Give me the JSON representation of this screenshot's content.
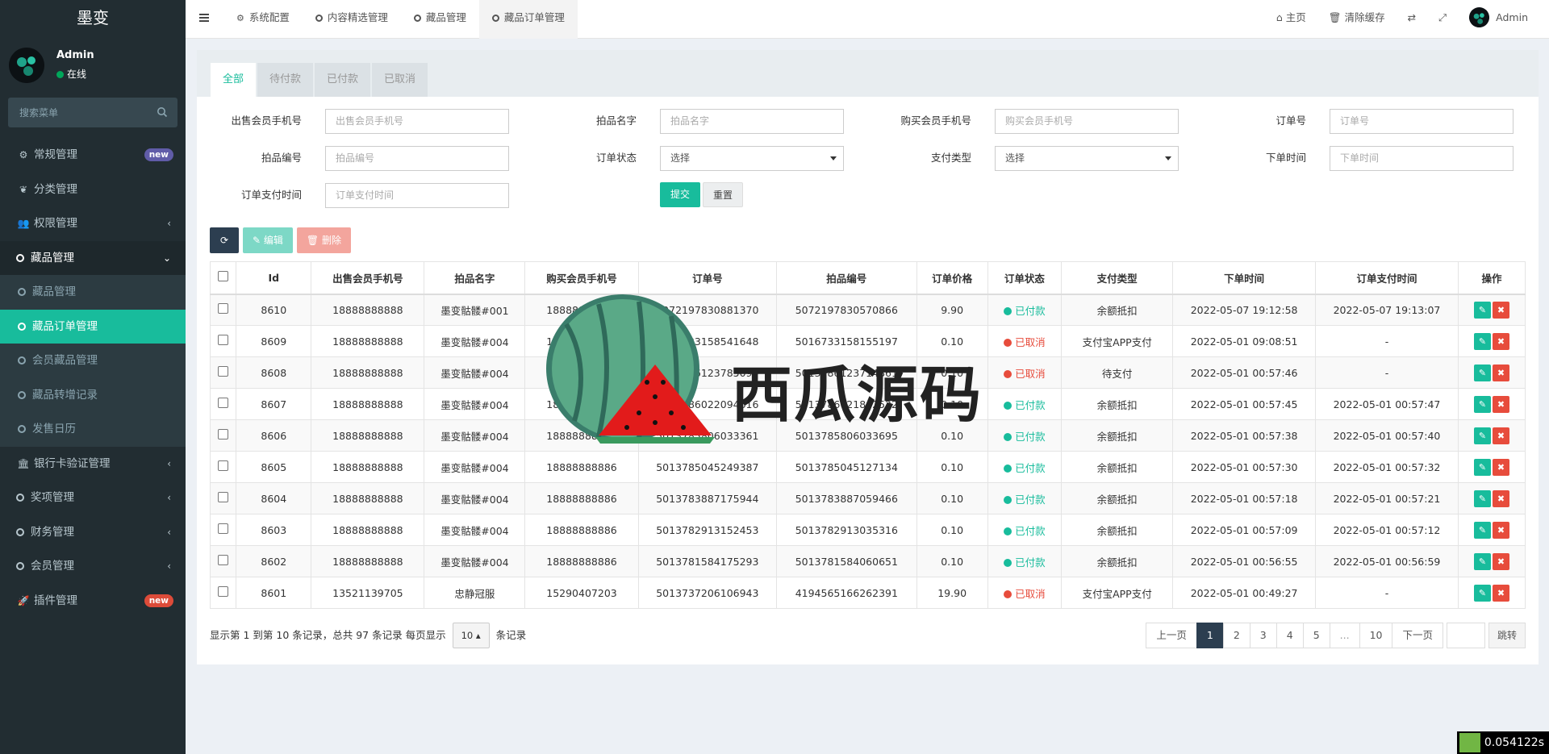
{
  "app": {
    "logo_text": "墨变",
    "user": {
      "name": "Admin",
      "status": "在线"
    },
    "search_placeholder": "搜索菜单"
  },
  "sidebar": {
    "items": [
      {
        "label": "常规管理",
        "icon": "gears-icon",
        "badge": "new",
        "badge_color": "#605ca8"
      },
      {
        "label": "分类管理",
        "icon": "leaf-icon"
      },
      {
        "label": "权限管理",
        "icon": "users-icon",
        "chevron": "left"
      },
      {
        "label": "藏品管理",
        "icon": "circle-icon",
        "chevron": "down",
        "expanded": true
      },
      {
        "label": "藏品管理",
        "icon": "circle-icon",
        "sub": true
      },
      {
        "label": "藏品订单管理",
        "icon": "circle-icon",
        "sub": true,
        "active": true
      },
      {
        "label": "会员藏品管理",
        "icon": "circle-icon",
        "sub": true
      },
      {
        "label": "藏品转增记录",
        "icon": "circle-icon",
        "sub": true
      },
      {
        "label": "发售日历",
        "icon": "circle-icon",
        "sub": true
      },
      {
        "label": "银行卡验证管理",
        "icon": "bank-icon",
        "chevron": "left"
      },
      {
        "label": "奖项管理",
        "icon": "circle-icon",
        "chevron": "left"
      },
      {
        "label": "财务管理",
        "icon": "circle-icon",
        "chevron": "left"
      },
      {
        "label": "会员管理",
        "icon": "circle-icon",
        "chevron": "left"
      },
      {
        "label": "插件管理",
        "icon": "rocket-icon",
        "badge": "new",
        "badge_color": "#dd4b39"
      }
    ]
  },
  "topbar": {
    "tabs": [
      {
        "label": "系统配置",
        "icon": "gear-icon"
      },
      {
        "label": "内容精选管理",
        "icon": "circle-icon"
      },
      {
        "label": "藏品管理",
        "icon": "circle-icon"
      },
      {
        "label": "藏品订单管理",
        "icon": "circle-icon",
        "active": true
      }
    ],
    "home_label": "主页",
    "clear_cache_label": "清除缓存",
    "user_name": "Admin"
  },
  "panel": {
    "tabs": [
      "全部",
      "待付款",
      "已付款",
      "已取消"
    ],
    "active_tab": 0
  },
  "filters": {
    "seller_phone": {
      "label": "出售会员手机号",
      "placeholder": "出售会员手机号"
    },
    "item_name": {
      "label": "拍品名字",
      "placeholder": "拍品名字"
    },
    "buyer_phone": {
      "label": "购买会员手机号",
      "placeholder": "购买会员手机号"
    },
    "order_no": {
      "label": "订单号",
      "placeholder": "订单号"
    },
    "item_no": {
      "label": "拍品编号",
      "placeholder": "拍品编号"
    },
    "order_status": {
      "label": "订单状态",
      "value": "选择"
    },
    "pay_type": {
      "label": "支付类型",
      "value": "选择"
    },
    "order_time": {
      "label": "下单时间",
      "placeholder": "下单时间"
    },
    "pay_time": {
      "label": "订单支付时间",
      "placeholder": "订单支付时间"
    },
    "submit_label": "提交",
    "reset_label": "重置"
  },
  "toolbar": {
    "edit_label": "编辑",
    "delete_label": "删除"
  },
  "table": {
    "columns": [
      "Id",
      "出售会员手机号",
      "拍品名字",
      "购买会员手机号",
      "订单号",
      "拍品编号",
      "订单价格",
      "订单状态",
      "支付类型",
      "下单时间",
      "订单支付时间",
      "操作"
    ],
    "rows": [
      {
        "id": "8610",
        "seller": "18888888888",
        "name": "墨变骷髅#001",
        "buyer": "18888888888",
        "order": "5072197830881370",
        "item": "5072197830570866",
        "price": "9.90",
        "status": "已付款",
        "status_type": "paid",
        "pay": "余额抵扣",
        "pay_type": "green",
        "created": "2022-05-07 19:12:58",
        "paid": "2022-05-07 19:13:07"
      },
      {
        "id": "8609",
        "seller": "18888888888",
        "name": "墨变骷髅#004",
        "buyer": "18950590989",
        "order": "5016733158541648",
        "item": "5016733158155197",
        "price": "0.10",
        "status": "已取消",
        "status_type": "cancel",
        "pay": "支付宝APP支付",
        "pay_type": "red",
        "created": "2022-05-01 09:08:51",
        "paid": "-"
      },
      {
        "id": "8608",
        "seller": "18888888888",
        "name": "墨变骷髅#004",
        "buyer": "18888888886",
        "order": "5013786123785099",
        "item": "5013786123714861",
        "price": "0.10",
        "status": "已取消",
        "status_type": "cancel",
        "pay": "待支付",
        "pay_type": "plain",
        "created": "2022-05-01 00:57:46",
        "paid": "-"
      },
      {
        "id": "8607",
        "seller": "18888888888",
        "name": "墨变骷髅#004",
        "buyer": "18888888886",
        "order": "5013786022094616",
        "item": "5013786021862522",
        "price": "0.10",
        "status": "已付款",
        "status_type": "paid",
        "pay": "余额抵扣",
        "pay_type": "green",
        "created": "2022-05-01 00:57:45",
        "paid": "2022-05-01 00:57:47"
      },
      {
        "id": "8606",
        "seller": "18888888888",
        "name": "墨变骷髅#004",
        "buyer": "18888888886",
        "order": "5013785806033361",
        "item": "5013785806033695",
        "price": "0.10",
        "status": "已付款",
        "status_type": "paid",
        "pay": "余额抵扣",
        "pay_type": "green",
        "created": "2022-05-01 00:57:38",
        "paid": "2022-05-01 00:57:40"
      },
      {
        "id": "8605",
        "seller": "18888888888",
        "name": "墨变骷髅#004",
        "buyer": "18888888886",
        "order": "5013785045249387",
        "item": "5013785045127134",
        "price": "0.10",
        "status": "已付款",
        "status_type": "paid",
        "pay": "余额抵扣",
        "pay_type": "green",
        "created": "2022-05-01 00:57:30",
        "paid": "2022-05-01 00:57:32"
      },
      {
        "id": "8604",
        "seller": "18888888888",
        "name": "墨变骷髅#004",
        "buyer": "18888888886",
        "order": "5013783887175944",
        "item": "5013783887059466",
        "price": "0.10",
        "status": "已付款",
        "status_type": "paid",
        "pay": "余额抵扣",
        "pay_type": "green",
        "created": "2022-05-01 00:57:18",
        "paid": "2022-05-01 00:57:21"
      },
      {
        "id": "8603",
        "seller": "18888888888",
        "name": "墨变骷髅#004",
        "buyer": "18888888886",
        "order": "5013782913152453",
        "item": "5013782913035316",
        "price": "0.10",
        "status": "已付款",
        "status_type": "paid",
        "pay": "余额抵扣",
        "pay_type": "green",
        "created": "2022-05-01 00:57:09",
        "paid": "2022-05-01 00:57:12"
      },
      {
        "id": "8602",
        "seller": "18888888888",
        "name": "墨变骷髅#004",
        "buyer": "18888888886",
        "order": "5013781584175293",
        "item": "5013781584060651",
        "price": "0.10",
        "status": "已付款",
        "status_type": "paid",
        "pay": "余额抵扣",
        "pay_type": "green",
        "created": "2022-05-01 00:56:55",
        "paid": "2022-05-01 00:56:59"
      },
      {
        "id": "8601",
        "seller": "13521139705",
        "name": "忠静冠服",
        "buyer": "15290407203",
        "order": "5013737206106943",
        "item": "4194565166262391",
        "price": "19.90",
        "status": "已取消",
        "status_type": "cancel",
        "pay": "支付宝APP支付",
        "pay_type": "red",
        "created": "2022-05-01 00:49:27",
        "paid": "-"
      }
    ]
  },
  "pagination": {
    "info_prefix": "显示第 1 到第 10 条记录，总共 97 条记录 每页显示",
    "page_size": "10",
    "info_suffix": "条记录",
    "prev_label": "上一页",
    "pages": [
      "1",
      "2",
      "3",
      "4",
      "5",
      "...",
      "10"
    ],
    "current_page": "1",
    "next_label": "下一页",
    "jump_label": "跳转"
  },
  "timer": "0.054122s",
  "watermark_text": "西瓜源码",
  "colors": {
    "accent": "#18bc9c",
    "danger": "#e74c3c",
    "sidebar_bg": "#222d32",
    "pager_active": "#2c3e50"
  }
}
